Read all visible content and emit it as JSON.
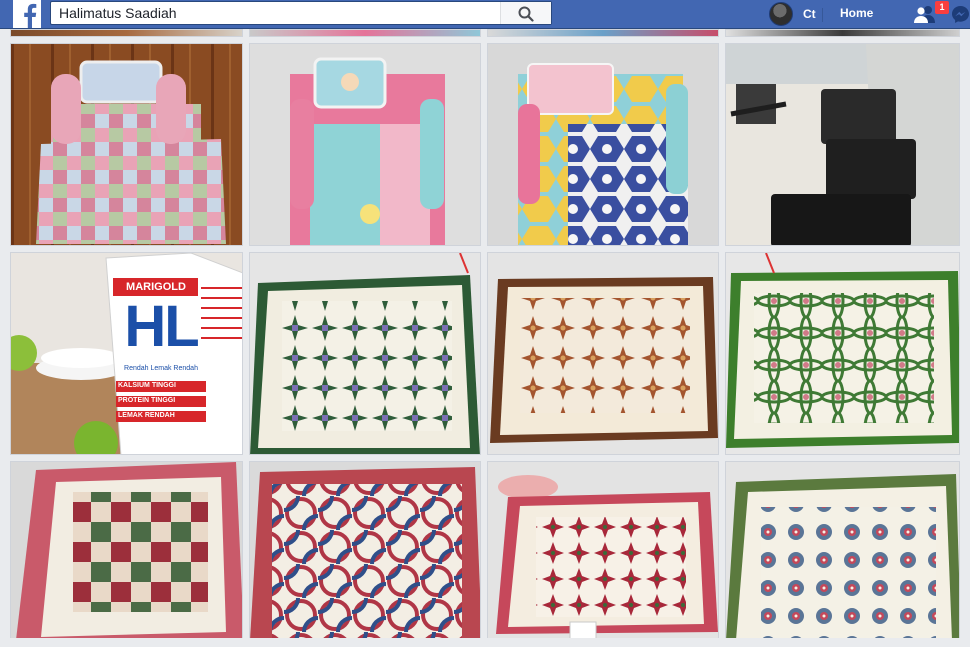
{
  "header": {
    "search_value": "Halimatus Saadiah",
    "profile_name": "Ct",
    "home_label": "Home",
    "friend_requests_badge": "1",
    "brand_color": "#4267b2"
  },
  "photos": {
    "milk_carton": {
      "brand": "MARIGOLD",
      "product": "HL",
      "line1": "Rendah Lemak Rendah",
      "line2": "KALSIUM TINGGI",
      "line3": "PROTEIN TINGGI",
      "line4": "LEMAK RENDAH"
    }
  }
}
